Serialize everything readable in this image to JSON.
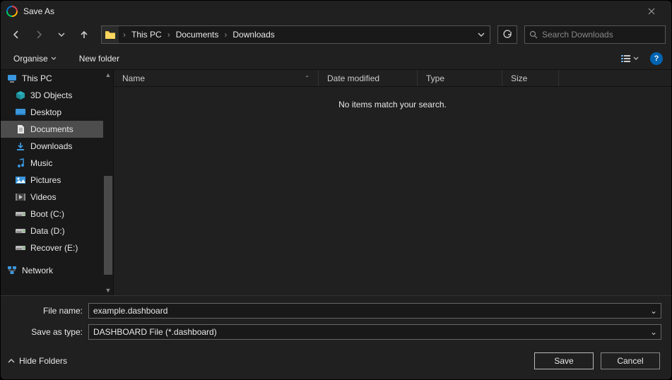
{
  "title": "Save As",
  "breadcrumb": {
    "items": [
      "This PC",
      "Documents",
      "Downloads"
    ]
  },
  "search": {
    "placeholder": "Search Downloads"
  },
  "toolbar": {
    "organise": "Organise",
    "new_folder": "New folder"
  },
  "sidebar": {
    "root": "This PC",
    "items": [
      {
        "label": "3D Objects",
        "icon": "cube"
      },
      {
        "label": "Desktop",
        "icon": "desktop"
      },
      {
        "label": "Documents",
        "icon": "doc",
        "selected": true
      },
      {
        "label": "Downloads",
        "icon": "download"
      },
      {
        "label": "Music",
        "icon": "music"
      },
      {
        "label": "Pictures",
        "icon": "pictures"
      },
      {
        "label": "Videos",
        "icon": "video"
      },
      {
        "label": "Boot (C:)",
        "icon": "drive"
      },
      {
        "label": "Data (D:)",
        "icon": "drive"
      },
      {
        "label": "Recover (E:)",
        "icon": "drive"
      }
    ],
    "network": "Network"
  },
  "columns": {
    "name": "Name",
    "date": "Date modified",
    "type": "Type",
    "size": "Size"
  },
  "empty_message": "No items match your search.",
  "fields": {
    "file_name_label": "File name:",
    "file_name_value": "example.dashboard",
    "save_type_label": "Save as type:",
    "save_type_value": "DASHBOARD File (*.dashboard)"
  },
  "footer": {
    "hide_folders": "Hide Folders",
    "save": "Save",
    "cancel": "Cancel"
  },
  "help_label": "?"
}
